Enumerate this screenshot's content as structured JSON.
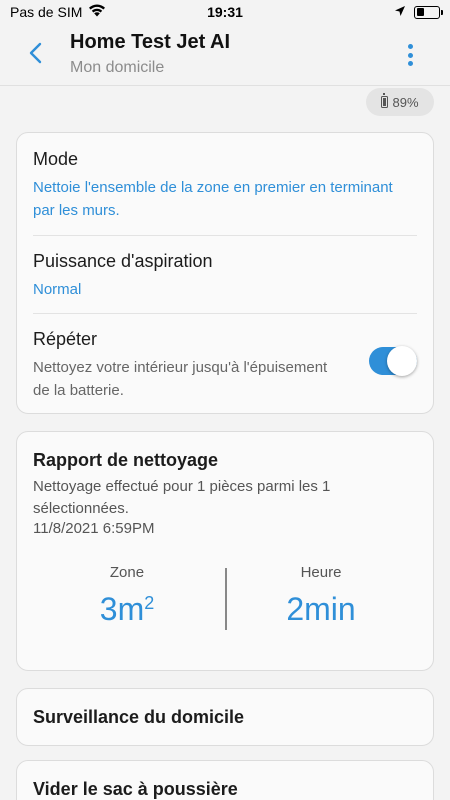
{
  "status_bar": {
    "carrier": "Pas de SIM",
    "time": "19:31"
  },
  "header": {
    "title": "Home Test Jet AI",
    "subtitle": "Mon domicile"
  },
  "battery": {
    "percent_label": "89%"
  },
  "settings": {
    "mode": {
      "label": "Mode",
      "value": "Nettoie l'ensemble de la zone en premier en terminant par les murs."
    },
    "puissance": {
      "label": "Puissance d'aspiration",
      "value": "Normal"
    },
    "repeter": {
      "label": "Répéter",
      "description": "Nettoyez votre intérieur jusqu'à l'épuisement de la batterie.",
      "enabled": true
    }
  },
  "report": {
    "title": "Rapport de nettoyage",
    "description": "Nettoyage effectué pour 1 pièces parmi les 1 sélectionnées.",
    "date": "11/8/2021 6:59PM",
    "zone_label": "Zone",
    "zone_value": "3m",
    "zone_unit_sup": "2",
    "heure_label": "Heure",
    "heure_value": "2min"
  },
  "cards": {
    "surveillance": "Surveillance du domicile",
    "vider": "Vider le sac à poussière"
  },
  "colors": {
    "accent": "#2f8fd8",
    "background": "#f3f3f3"
  }
}
